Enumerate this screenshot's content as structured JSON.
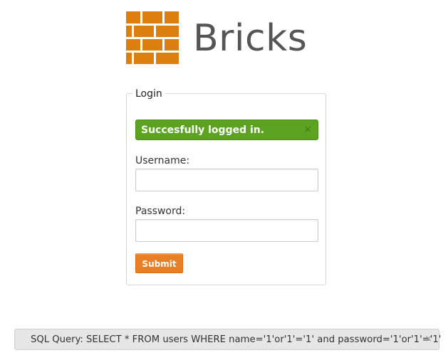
{
  "logo": {
    "text": "Bricks",
    "color": "#dd7f0f",
    "text_color": "#555555"
  },
  "login": {
    "legend": "Login",
    "alert": {
      "message": "Succesfully logged in.",
      "close_icon": "×",
      "color": "#5ba321"
    },
    "username": {
      "label": "Username:",
      "value": "",
      "placeholder": ""
    },
    "password": {
      "label": "Password:",
      "value": "",
      "placeholder": ""
    },
    "submit_label": "Submit",
    "submit_color": "#e87f24"
  },
  "sql_bar": {
    "text": "SQL Query: SELECT * FROM users WHERE name='1'or'1'='1' and password='1'or'1'='1'",
    "close_icon": "×"
  }
}
